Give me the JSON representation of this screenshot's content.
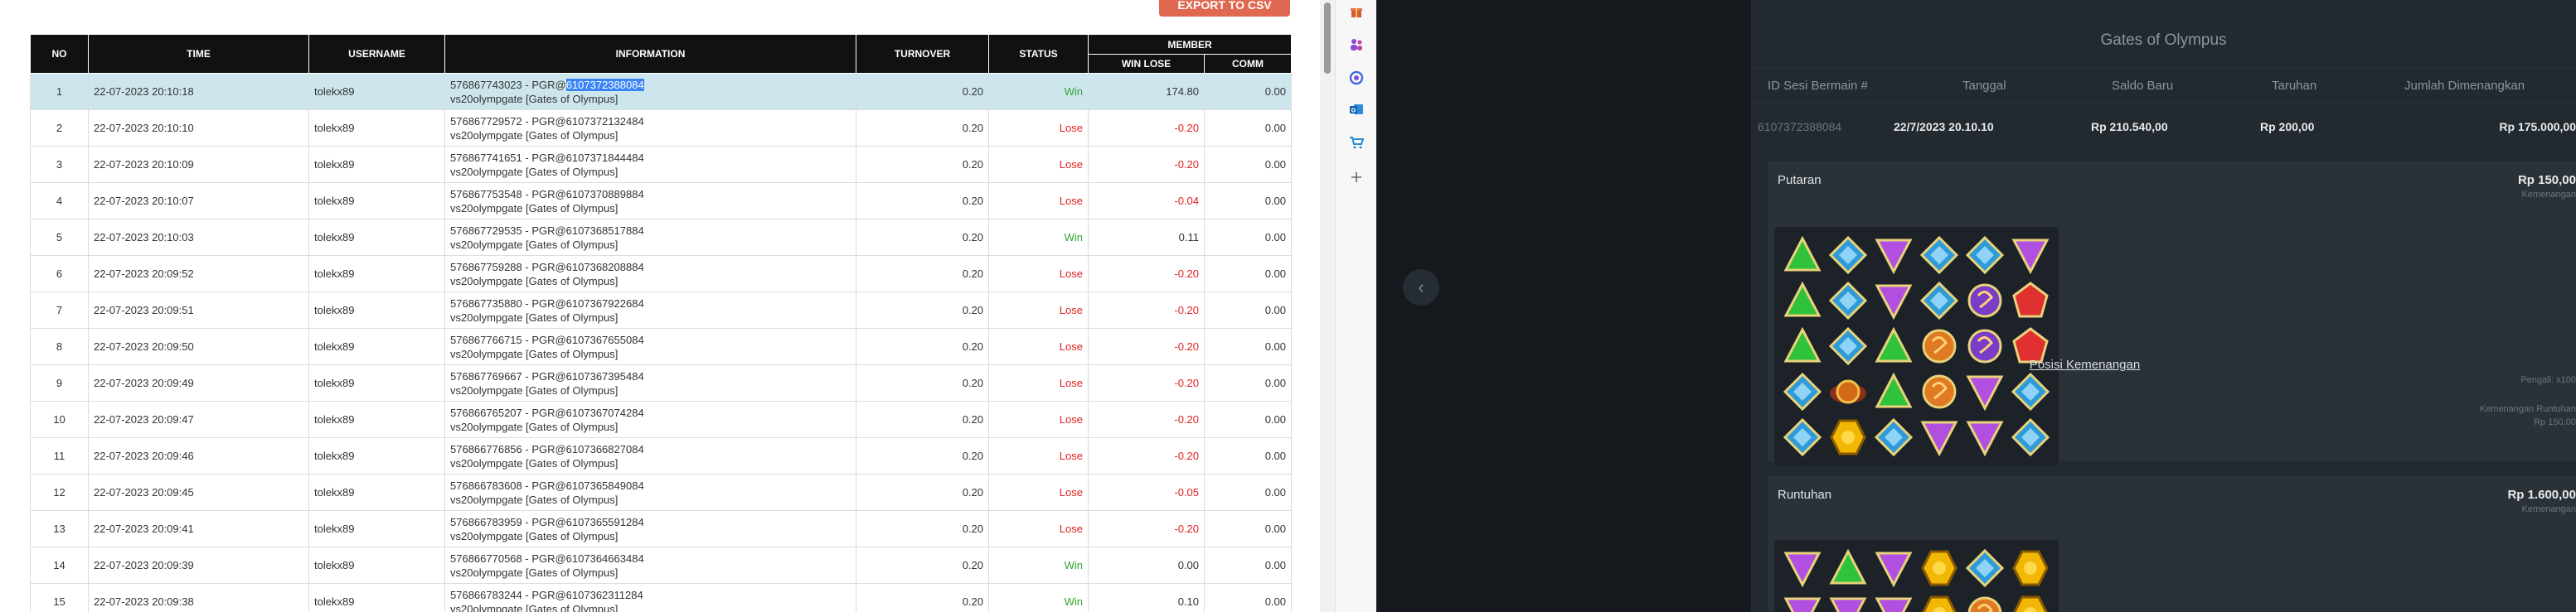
{
  "left": {
    "export_label": "EXPORT TO CSV",
    "headers": {
      "no": "NO",
      "time": "TIME",
      "username": "USERNAME",
      "information": "INFORMATION",
      "turnover": "TURNOVER",
      "status": "STATUS",
      "member": "MEMBER",
      "win_lose": "WIN LOSE",
      "comm": "COMM"
    },
    "rows": [
      {
        "no": "1",
        "time": "22-07-2023 20:10:18",
        "user": "tolekx89",
        "info_pre": "576867743023 - PGR@",
        "info_hl": "6107372388084",
        "info2": "vs20olympgate [Gates of Olympus]",
        "turnover": "0.20",
        "status": "Win",
        "winlose": "174.80",
        "comm": "0.00"
      },
      {
        "no": "2",
        "time": "22-07-2023 20:10:10",
        "user": "tolekx89",
        "info_pre": "576867729572 - PGR@6107372132484",
        "info_hl": "",
        "info2": "vs20olympgate [Gates of Olympus]",
        "turnover": "0.20",
        "status": "Lose",
        "winlose": "-0.20",
        "comm": "0.00"
      },
      {
        "no": "3",
        "time": "22-07-2023 20:10:09",
        "user": "tolekx89",
        "info_pre": "576867741651 - PGR@6107371844484",
        "info_hl": "",
        "info2": "vs20olympgate [Gates of Olympus]",
        "turnover": "0.20",
        "status": "Lose",
        "winlose": "-0.20",
        "comm": "0.00"
      },
      {
        "no": "4",
        "time": "22-07-2023 20:10:07",
        "user": "tolekx89",
        "info_pre": "576867753548 - PGR@6107370889884",
        "info_hl": "",
        "info2": "vs20olympgate [Gates of Olympus]",
        "turnover": "0.20",
        "status": "Lose",
        "winlose": "-0.04",
        "comm": "0.00"
      },
      {
        "no": "5",
        "time": "22-07-2023 20:10:03",
        "user": "tolekx89",
        "info_pre": "576867729535 - PGR@6107368517884",
        "info_hl": "",
        "info2": "vs20olympgate [Gates of Olympus]",
        "turnover": "0.20",
        "status": "Win",
        "winlose": "0.11",
        "comm": "0.00"
      },
      {
        "no": "6",
        "time": "22-07-2023 20:09:52",
        "user": "tolekx89",
        "info_pre": "576867759288 - PGR@6107368208884",
        "info_hl": "",
        "info2": "vs20olympgate [Gates of Olympus]",
        "turnover": "0.20",
        "status": "Lose",
        "winlose": "-0.20",
        "comm": "0.00"
      },
      {
        "no": "7",
        "time": "22-07-2023 20:09:51",
        "user": "tolekx89",
        "info_pre": "576867735880 - PGR@6107367922684",
        "info_hl": "",
        "info2": "vs20olympgate [Gates of Olympus]",
        "turnover": "0.20",
        "status": "Lose",
        "winlose": "-0.20",
        "comm": "0.00"
      },
      {
        "no": "8",
        "time": "22-07-2023 20:09:50",
        "user": "tolekx89",
        "info_pre": "576867766715 - PGR@6107367655084",
        "info_hl": "",
        "info2": "vs20olympgate [Gates of Olympus]",
        "turnover": "0.20",
        "status": "Lose",
        "winlose": "-0.20",
        "comm": "0.00"
      },
      {
        "no": "9",
        "time": "22-07-2023 20:09:49",
        "user": "tolekx89",
        "info_pre": "576867769667 - PGR@6107367395484",
        "info_hl": "",
        "info2": "vs20olympgate [Gates of Olympus]",
        "turnover": "0.20",
        "status": "Lose",
        "winlose": "-0.20",
        "comm": "0.00"
      },
      {
        "no": "10",
        "time": "22-07-2023 20:09:47",
        "user": "tolekx89",
        "info_pre": "576866765207 - PGR@6107367074284",
        "info_hl": "",
        "info2": "vs20olympgate [Gates of Olympus]",
        "turnover": "0.20",
        "status": "Lose",
        "winlose": "-0.20",
        "comm": "0.00"
      },
      {
        "no": "11",
        "time": "22-07-2023 20:09:46",
        "user": "tolekx89",
        "info_pre": "576866776856 - PGR@6107366827084",
        "info_hl": "",
        "info2": "vs20olympgate [Gates of Olympus]",
        "turnover": "0.20",
        "status": "Lose",
        "winlose": "-0.20",
        "comm": "0.00"
      },
      {
        "no": "12",
        "time": "22-07-2023 20:09:45",
        "user": "tolekx89",
        "info_pre": "576866783608 - PGR@6107365849084",
        "info_hl": "",
        "info2": "vs20olympgate [Gates of Olympus]",
        "turnover": "0.20",
        "status": "Lose",
        "winlose": "-0.05",
        "comm": "0.00"
      },
      {
        "no": "13",
        "time": "22-07-2023 20:09:41",
        "user": "tolekx89",
        "info_pre": "576866783959 - PGR@6107365591284",
        "info_hl": "",
        "info2": "vs20olympgate [Gates of Olympus]",
        "turnover": "0.20",
        "status": "Lose",
        "winlose": "-0.20",
        "comm": "0.00"
      },
      {
        "no": "14",
        "time": "22-07-2023 20:09:39",
        "user": "tolekx89",
        "info_pre": "576866770568 - PGR@6107364663484",
        "info_hl": "",
        "info2": "vs20olympgate [Gates of Olympus]",
        "turnover": "0.20",
        "status": "Win",
        "winlose": "0.00",
        "comm": "0.00"
      },
      {
        "no": "15",
        "time": "22-07-2023 20:09:38",
        "user": "tolekx89",
        "info_pre": "576866783244 - PGR@6107362311284",
        "info_hl": "",
        "info2": "vs20olympgate [Gates of Olympus]",
        "turnover": "0.20",
        "status": "Win",
        "winlose": "0.10",
        "comm": "0.00"
      }
    ]
  },
  "side_icons": [
    "gift-icon",
    "people-icon",
    "puzzle-icon",
    "outlook-icon",
    "cart-icon",
    "plus-icon"
  ],
  "right": {
    "title": "Gates of Olympus",
    "headers": {
      "session_id": "ID Sesi Bermain #",
      "date": "Tanggal",
      "new_balance": "Saldo Baru",
      "bet": "Taruhan",
      "total_won": "Jumlah Dimenangkan"
    },
    "row": {
      "session_id": "6107372388084",
      "date": "22/7/2023 20.10.10",
      "new_balance": "Rp 210.540,00",
      "bet": "Rp 200,00",
      "total_won": "Rp 175.000,00"
    },
    "spin": {
      "title": "Putaran",
      "amount": "Rp 150,00",
      "sub": "Kemenangan",
      "multiplier_note": "Pengali: x100",
      "cascade_note": "Kemenangan Runtuhan",
      "cascade_amount": "Rp 150,00",
      "win_positions_label": "Posisi Kemenangan"
    },
    "cascade": {
      "title": "Runtuhan",
      "amount": "Rp 1.600,00",
      "sub": "Kemenangan"
    },
    "gem_legend": {
      "G": "green-triangle-gem",
      "B": "blue-diamond-gem",
      "P": "purple-triangle-gem",
      "O": "orange-swirl-gem",
      "R": "red-pentagon-gem",
      "Y": "yellow-hexagon-gem",
      "V": "violet-swirl-gem",
      "X": "multiplier-orb"
    },
    "colors": {
      "G": "#2fc23a",
      "B": "#2e9bd8",
      "P": "#b04fe0",
      "O": "#e07a22",
      "R": "#e03030",
      "Y": "#f2b705",
      "V": "#7a3dc8",
      "X": "#d26a1a"
    },
    "spin_grid": [
      [
        "G",
        "B",
        "P",
        "B",
        "B",
        "P"
      ],
      [
        "G",
        "B",
        "P",
        "B",
        "V",
        "R"
      ],
      [
        "G",
        "B",
        "G",
        "O",
        "V",
        "R"
      ],
      [
        "B",
        "X",
        "G",
        "O",
        "P",
        "B"
      ],
      [
        "B",
        "Y",
        "B",
        "P",
        "P",
        "B"
      ]
    ],
    "cascade_grid": [
      [
        "P",
        "G",
        "P",
        "Y",
        "B",
        "Y"
      ],
      [
        "P",
        "P",
        "P",
        "Y",
        "O",
        "Y"
      ]
    ]
  }
}
